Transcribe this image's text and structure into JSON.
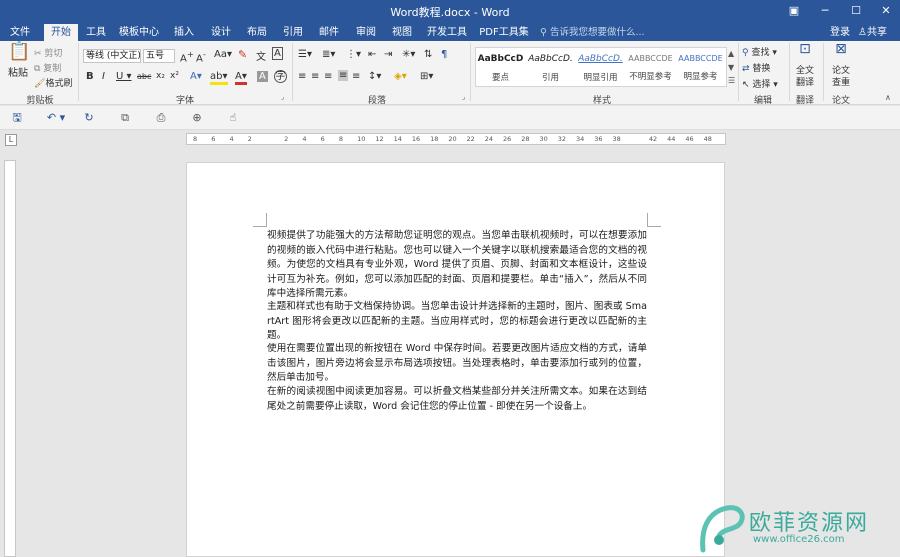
{
  "window": {
    "title": "Word教程.docx - Word"
  },
  "tabs": [
    "文件",
    "开始",
    "工具",
    "模板中心",
    "插入",
    "设计",
    "布局",
    "引用",
    "邮件",
    "审阅",
    "视图",
    "开发工具",
    "PDF工具集"
  ],
  "tell_me": "告诉我您想要做什么...",
  "account": {
    "login": "登录",
    "share": "共享"
  },
  "clipboard": {
    "paste": "粘贴",
    "cut": "剪切",
    "copy": "复制",
    "format_painter": "格式刷",
    "label": "剪贴板"
  },
  "font": {
    "name": "等线 (中文正)",
    "size": "五号",
    "label": "字体"
  },
  "paragraph": {
    "label": "段落"
  },
  "styles": {
    "label": "样式",
    "items": [
      {
        "preview": "AaBbCcD",
        "name": "要点"
      },
      {
        "preview": "AaBbCcD.",
        "name": "引用"
      },
      {
        "preview": "AaBbCcD.",
        "name": "明显引用"
      },
      {
        "preview": "AABBCCDE",
        "name": "不明显参考"
      },
      {
        "preview": "AABBCCDE",
        "name": "明显参考"
      }
    ]
  },
  "editing": {
    "find": "查找",
    "replace": "替换",
    "select": "选择",
    "label": "编辑"
  },
  "translate": {
    "btn1": "全文",
    "btn2": "翻译",
    "label": "翻译"
  },
  "paper": {
    "btn1": "论文",
    "btn2": "查重",
    "label": "论文"
  },
  "ruler": {
    "ticks": [
      "8",
      "6",
      "4",
      "2",
      "",
      "2",
      "4",
      "6",
      "8",
      "10",
      "12",
      "14",
      "16",
      "18",
      "20",
      "22",
      "24",
      "26",
      "28",
      "30",
      "32",
      "34",
      "36",
      "38",
      "",
      "42",
      "44",
      "46",
      "48"
    ],
    "corner": "L"
  },
  "document": {
    "paragraphs": [
      "视频提供了功能强大的方法帮助您证明您的观点。当您单击联机视频时，可以在想要添加的视频的嵌入代码中进行粘贴。您也可以键入一个关键字以联机搜索最适合您的文档的视频。为使您的文档具有专业外观，Word 提供了页眉、页脚、封面和文本框设计，这些设计可互为补充。例如，您可以添加匹配的封面、页眉和提要栏。单击“插入”，然后从不同库中选择所需元素。",
      "主题和样式也有助于文档保持协调。当您单击设计并选择新的主题时，图片、图表或 SmartArt 图形将会更改以匹配新的主题。当应用样式时，您的标题会进行更改以匹配新的主题。",
      "使用在需要位置出现的新按钮在 Word 中保存时间。若要更改图片适应文档的方式，请单击该图片，图片旁边将会显示布局选项按钮。当处理表格时，单击要添加行或列的位置，然后单击加号。",
      "在新的阅读视图中阅读更加容易。可以折叠文档某些部分并关注所需文本。如果在达到结尾处之前需要停止读取，Word 会记住您的停止位置 - 即使在另一个设备上。"
    ]
  },
  "watermark": {
    "text": "欧菲资源网",
    "url": "www.office26.com"
  }
}
